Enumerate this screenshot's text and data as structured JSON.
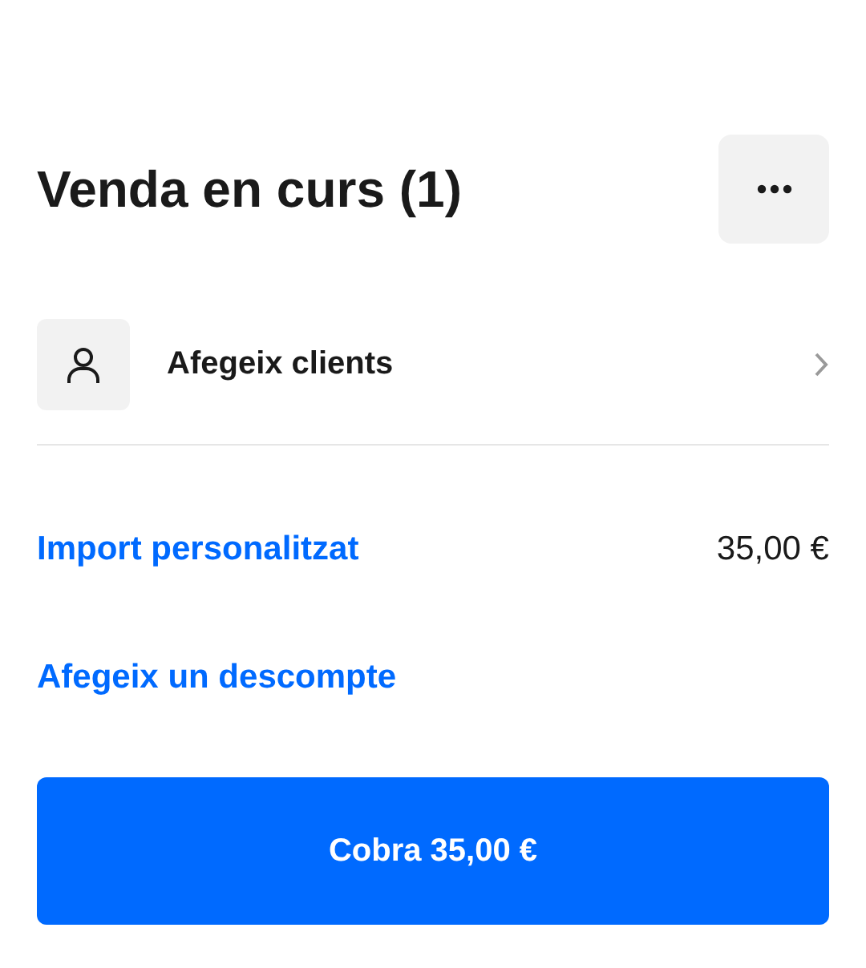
{
  "header": {
    "title": "Venda en curs (1)"
  },
  "customer": {
    "label": "Afegeix clients"
  },
  "line_items": [
    {
      "label": "Import personalitzat",
      "amount": "35,00 €"
    }
  ],
  "discount": {
    "label": "Afegeix un descompte"
  },
  "charge_button": {
    "label": "Cobra 35,00 €"
  }
}
